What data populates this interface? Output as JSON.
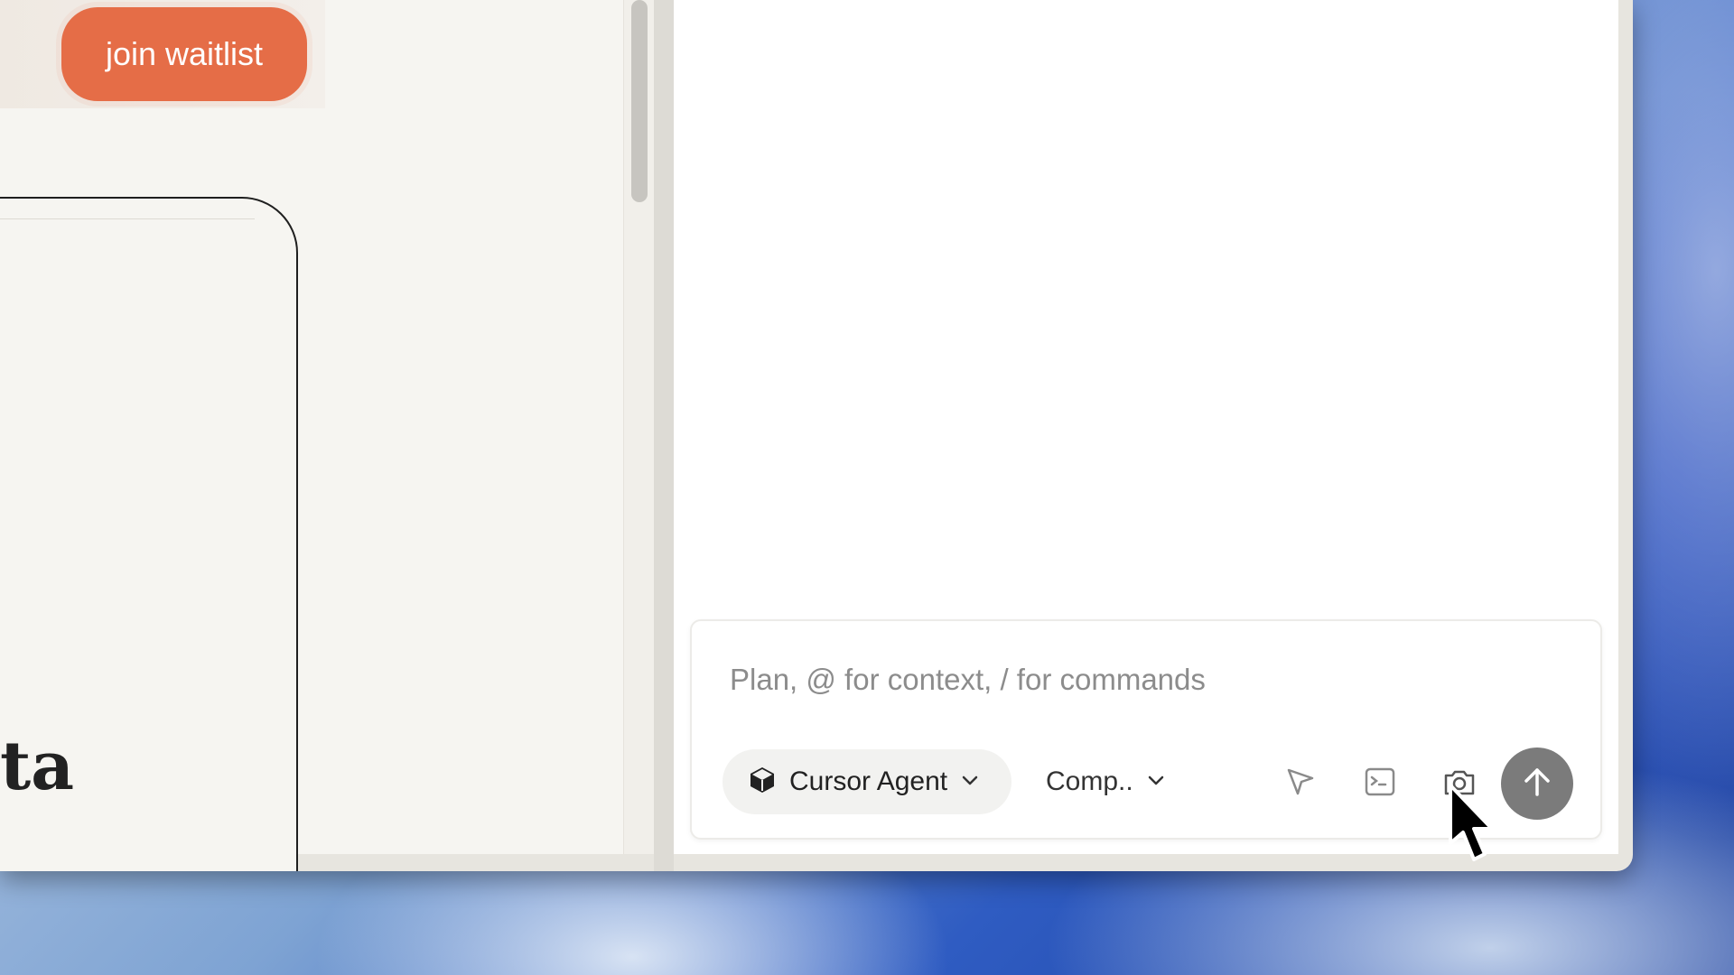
{
  "left_pane": {
    "join_button_label": "join waitlist",
    "card_text": "ta"
  },
  "composer": {
    "placeholder": "Plan, @ for context, / for commands",
    "agent_label": "Cursor Agent",
    "model_label": "Comp..",
    "icons": [
      "cube-icon",
      "chevron-down-icon",
      "pointer-select-icon",
      "terminal-icon",
      "camera-icon",
      "arrow-up-icon"
    ]
  },
  "colors": {
    "accent": "#e56d47",
    "send_button": "#7b7b7b"
  }
}
